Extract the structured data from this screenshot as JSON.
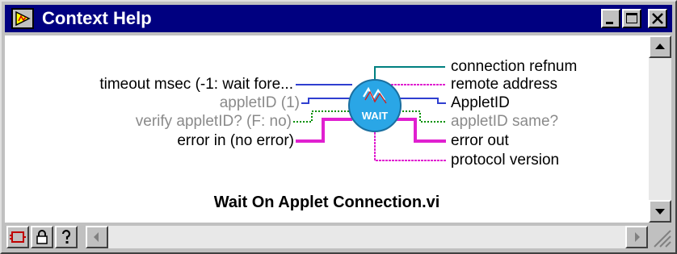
{
  "window": {
    "title": "Context Help"
  },
  "diagram": {
    "icon_text": "WAIT",
    "inputs": [
      {
        "label": "timeout msec (-1: wait fore...",
        "style": "required"
      },
      {
        "label": "appletID (1)",
        "style": "optional"
      },
      {
        "label": "verify appletID? (F: no)",
        "style": "optional"
      },
      {
        "label": "error in (no error)",
        "style": "required"
      }
    ],
    "outputs": [
      {
        "label": "connection refnum",
        "style": "required"
      },
      {
        "label": "remote address",
        "style": "required"
      },
      {
        "label": "AppletID",
        "style": "required"
      },
      {
        "label": "appletID same?",
        "style": "optional"
      },
      {
        "label": "error out",
        "style": "required"
      },
      {
        "label": "protocol version",
        "style": "required"
      }
    ],
    "vi_name": "Wait On Applet Connection.vi"
  },
  "colors": {
    "titlebar": "#000080",
    "numeric_wire": "#2f3fd0",
    "refnum_wire": "#008080",
    "string_wire": "#e020d0",
    "bool_wire": "#009000",
    "icon_fill": "#2aa6e6"
  }
}
